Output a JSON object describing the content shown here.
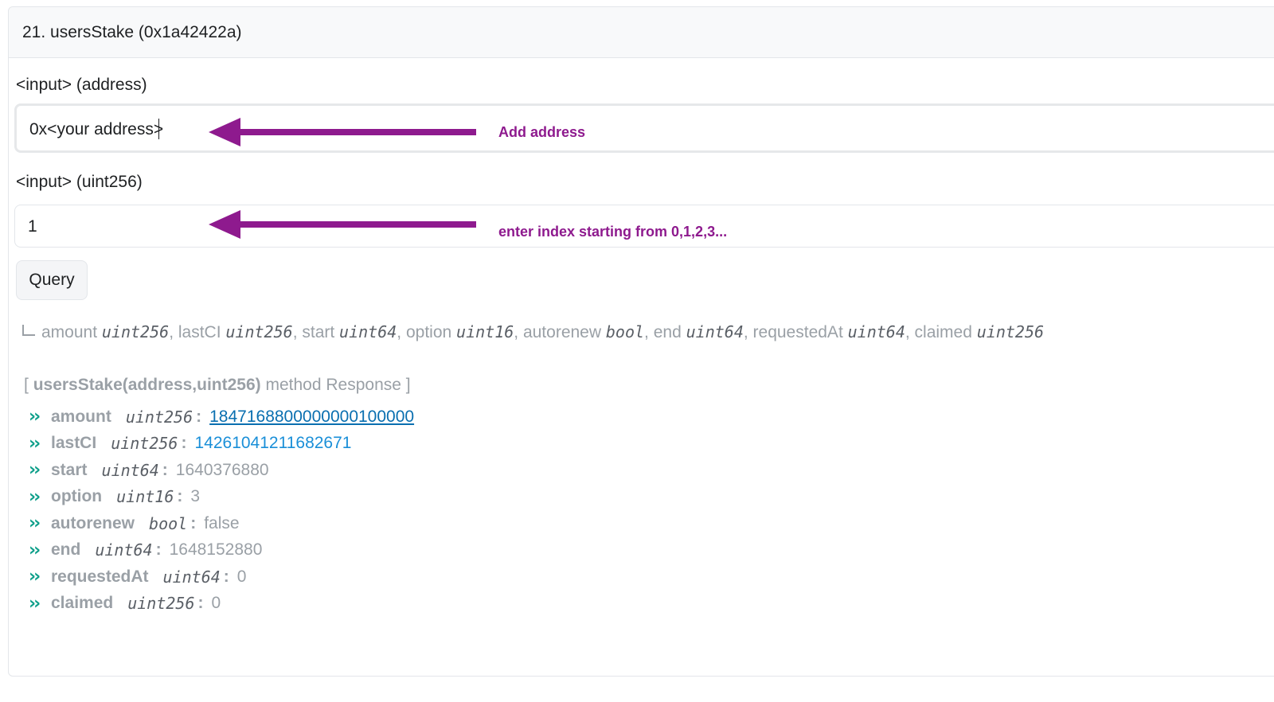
{
  "header": {
    "title": "21. usersStake (0x1a42422a)"
  },
  "inputs": [
    {
      "label": "<input> (address)",
      "value": "0x<your address>",
      "annotation": "Add address"
    },
    {
      "label": "<input> (uint256)",
      "value": "1",
      "annotation": "enter index starting from 0,1,2,3..."
    }
  ],
  "query_label": "Query",
  "signature": [
    {
      "name": "amount",
      "type": "uint256"
    },
    {
      "name": "lastCI",
      "type": "uint256"
    },
    {
      "name": "start",
      "type": "uint64"
    },
    {
      "name": "option",
      "type": "uint16"
    },
    {
      "name": "autorenew",
      "type": "bool"
    },
    {
      "name": "end",
      "type": "uint64"
    },
    {
      "name": "requestedAt",
      "type": "uint64"
    },
    {
      "name": "claimed",
      "type": "uint256"
    }
  ],
  "response": {
    "open_bracket": "[",
    "method": "usersStake(address,uint256)",
    "suffix": "method Response ]",
    "rows": [
      {
        "name": "amount",
        "type": "uint256",
        "value": "1847168800000000100000"
      },
      {
        "name": "lastCI",
        "type": "uint256",
        "value": "14261041211682671"
      },
      {
        "name": "start",
        "type": "uint64",
        "value": "1640376880"
      },
      {
        "name": "option",
        "type": "uint16",
        "value": "3"
      },
      {
        "name": "autorenew",
        "type": "bool",
        "value": "false"
      },
      {
        "name": "end",
        "type": "uint64",
        "value": "1648152880"
      },
      {
        "name": "requestedAt",
        "type": "uint64",
        "value": "0"
      },
      {
        "name": "claimed",
        "type": "uint256",
        "value": "0"
      }
    ]
  },
  "colors": {
    "annotation": "#8e1a8e",
    "chevron": "#0e9f8a",
    "link": "#0a6fb0"
  },
  "icons": {
    "row_marker": "double-chevron-right-icon",
    "return_marker": "return-corner-icon",
    "annotation_arrow": "arrow-left-icon"
  }
}
